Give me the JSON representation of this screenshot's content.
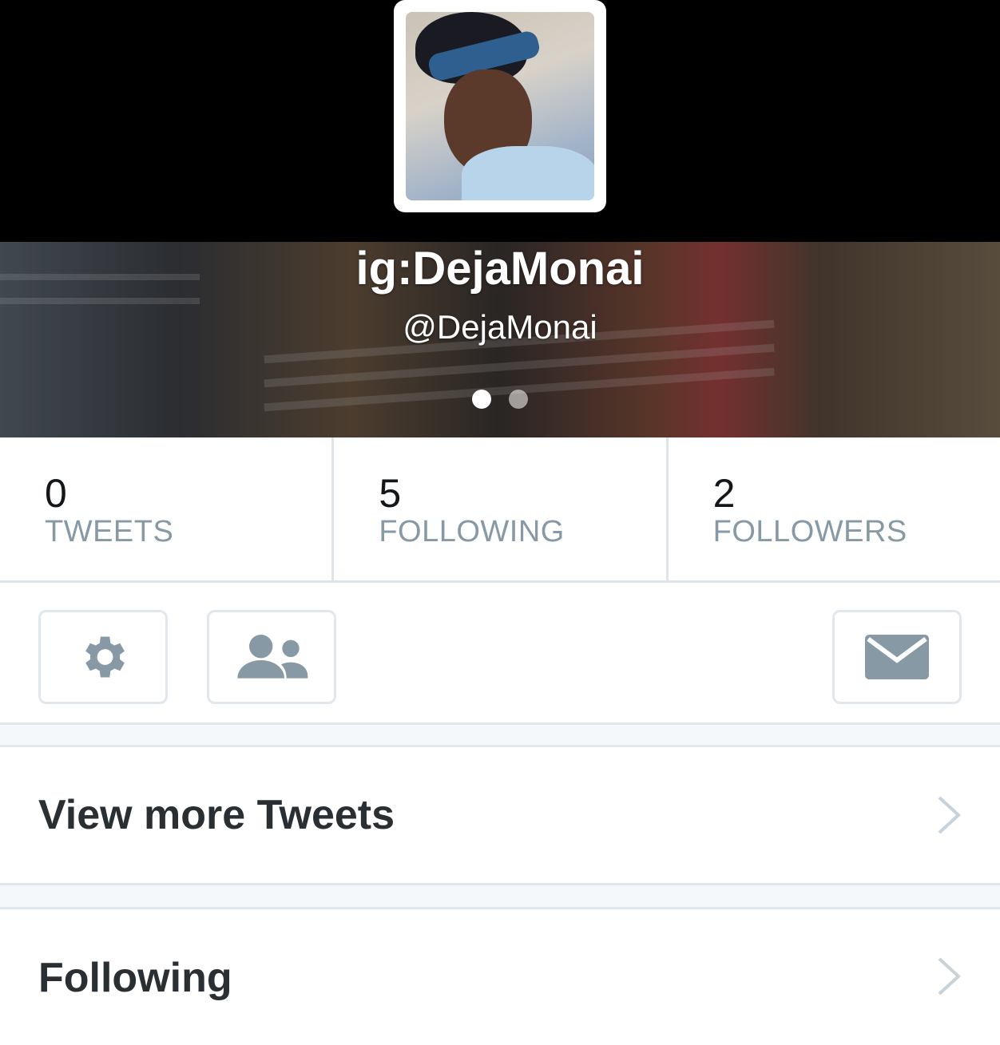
{
  "profile": {
    "name": "ig:DejaMonai",
    "handle": "@DejaMonai"
  },
  "banner": {
    "page_count": 2,
    "active_page": 1
  },
  "stats": [
    {
      "value": "0",
      "label": "TWEETS"
    },
    {
      "value": "5",
      "label": "FOLLOWING"
    },
    {
      "value": "2",
      "label": "FOLLOWERS"
    }
  ],
  "actions": {
    "settings_icon": "gear-icon",
    "people_icon": "people-icon",
    "message_icon": "envelope-icon"
  },
  "rows": [
    {
      "label": "View more Tweets"
    },
    {
      "label": "Following"
    }
  ],
  "colors": {
    "text_primary": "#292f33",
    "text_secondary": "#8899a6",
    "border": "#e1e8ed",
    "icon": "#8899a6"
  }
}
